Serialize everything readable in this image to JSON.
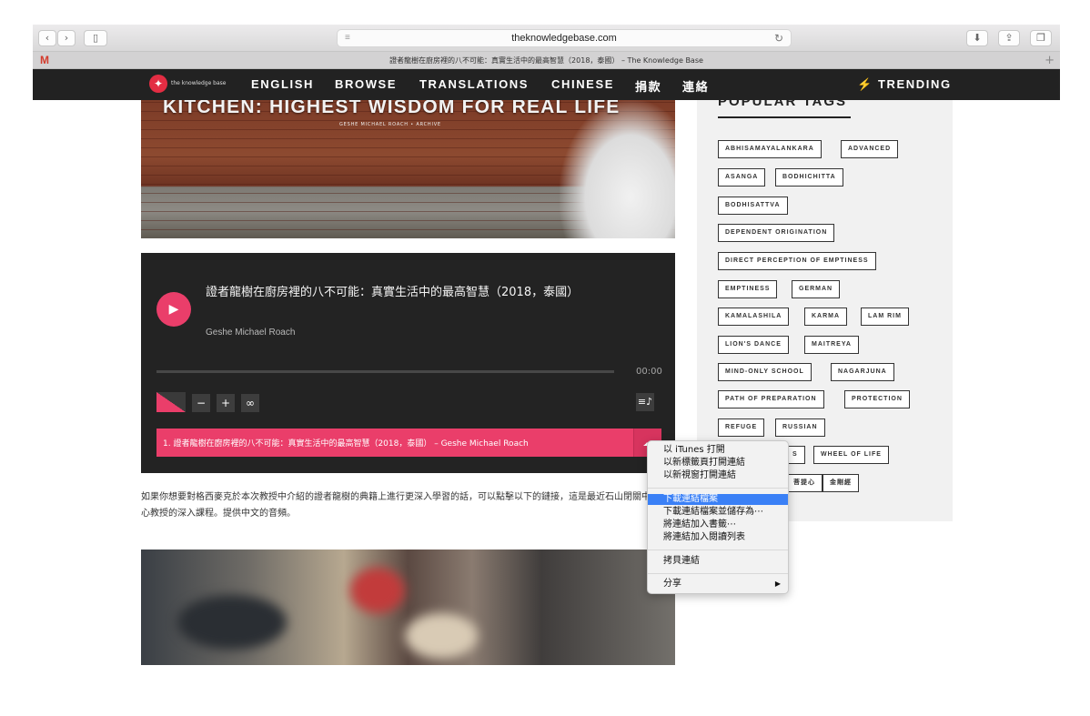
{
  "browser": {
    "back_icon": "‹",
    "forward_icon": "›",
    "sidebar_icon": "▯",
    "url": "theknowledgebase.com",
    "reader_icon": "≡",
    "reload_icon": "↻",
    "download_icon": "⬇",
    "share_icon": "⇪",
    "tabs_icon": "❐",
    "tab_title": "證者龍樹在廚房裡的八不可能：真實生活中的最高智慧（2018，泰國） – The Knowledge Base",
    "gmail_badge": "M",
    "new_tab_label": "+"
  },
  "nav": {
    "logo_text": "the knowledge base",
    "items": [
      "ENGLISH",
      "BROWSE",
      "TRANSLATIONS",
      "CHINESE",
      "捐款",
      "連絡"
    ],
    "trending": "⚡ TRENDING"
  },
  "hero": {
    "title": "KITCHEN: HIGHEST WISDOM FOR REAL LIFE",
    "subtitle": "GESHE MICHAEL ROACH • ARCHIVE"
  },
  "player": {
    "play_icon": "▶",
    "title": "證者龍樹在廚房裡的八不可能：真實生活中的最高智慧（2018，泰國）",
    "artist": "Geshe Michael Roach",
    "progress": 0,
    "time": "00:00",
    "minus_label": "−",
    "plus_label": "+",
    "loop_label": "∞",
    "playlist_icon": "≡♪",
    "track_row": "1. 證者龍樹在廚房裡的八不可能：真實生活中的最高智慧（2018，泰國） – Geshe Michael Roach",
    "download_icon": "☁"
  },
  "paragraph": "如果你想要對格西麥克於本次教授中介紹的證者龍樹的典籍上進行更深入學習的話，可以點擊以下的鏈接，這是最近石山閉關中心教授的深入課程。提供中文的音頻。",
  "sidebar": {
    "title": "POPULAR TAGS",
    "tags": [
      "ABHISAMAYALANKARA",
      "ADVANCED",
      "ASANGA",
      "BODHICHITTA",
      "BODHISATTVA",
      "DEPENDENT ORIGINATION",
      "DIRECT PERCEPTION OF EMPTINESS",
      "EMPTINESS",
      "GERMAN",
      "KAMALASHILA",
      "KARMA",
      "LAM RIM",
      "LION'S DANCE",
      "MAITREYA",
      "MIND-ONLY SCHOOL",
      "NAGARJUNA",
      "PATH OF PREPARATION",
      "PROTECTION",
      "REFUGE",
      "RUSSIAN",
      "S",
      "WHEEL OF LIFE",
      "菩提心",
      "金剛經"
    ]
  },
  "context_menu": {
    "items": [
      "以 iTunes 打開",
      "以新標籤頁打開連結",
      "以新視窗打開連結",
      "下載連結檔案",
      "下載連結檔案並儲存為⋯",
      "將連結加入書籤⋯",
      "將連結加入閱讀列表",
      "拷貝連結",
      "分享"
    ],
    "selected": "下載連結檔案",
    "submenu_arrow": "▶"
  },
  "colors": {
    "accent": "#ea3e6a",
    "nav_bg": "#222222",
    "player_bg": "#232323",
    "menu_highlight": "#3a80f6"
  }
}
